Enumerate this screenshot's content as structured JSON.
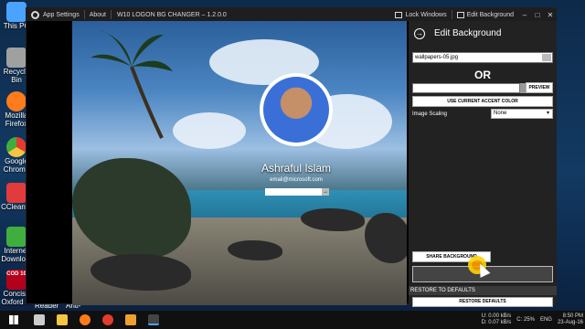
{
  "desktop": {
    "icons": [
      {
        "label": "This PC",
        "color": "#4aa3ff"
      },
      {
        "label": "Recycle Bin",
        "color": "#a0a0a0"
      },
      {
        "label": "Mozilla Firefox",
        "color": "#ff7b1b"
      },
      {
        "label": "Google Chrome",
        "color": "#e33b2e"
      },
      {
        "label": "CCleaner",
        "color": "#e23b3b"
      },
      {
        "label": "Internet Downlo...",
        "color": "#3fae3f"
      },
      {
        "label": "Concise Oxford ...",
        "color": "#b3001b",
        "badge": "COD 10"
      }
    ],
    "bottom_labels": [
      "Reader 9",
      "Anti-Mal..."
    ]
  },
  "app": {
    "title_settings": "App Settings",
    "title_about": "About",
    "window_title": "W10 LOGON BG CHANGER – 1.2.0.0",
    "lock_windows": "Lock Windows",
    "edit_background_tab": "Edit Background",
    "win_controls": {
      "minimize": "–",
      "maximize": "□",
      "close": "✕"
    }
  },
  "preview": {
    "user_name": "Ashraful Islam",
    "user_email": "email@microsoft.com",
    "go_arrow": "→"
  },
  "panel": {
    "title": "Edit Background",
    "file_name": "wallpapers-05.jpg",
    "or_label": "OR",
    "preview_button": "PREVIEW",
    "accent_button": "USE CURRENT ACCENT COLOR",
    "scaling_label": "Image Scaling",
    "scaling_value": "None",
    "share_button": "SHARE BACKGROUND",
    "restore_heading": "RESTORE TO DEFAULTS",
    "restore_button": "RESTORE DEFAULTS"
  },
  "taskbar": {
    "apps": [
      {
        "name": "search-icon",
        "color": "#cccccc"
      },
      {
        "name": "file-explorer-icon",
        "color": "#f4c542"
      },
      {
        "name": "firefox-icon",
        "color": "#ff7b1b"
      },
      {
        "name": "chrome-icon",
        "color": "#e33b2e"
      },
      {
        "name": "store-icon",
        "color": "#f0a030"
      },
      {
        "name": "w10-logon-app-icon",
        "color": "#444444"
      }
    ],
    "net_up": "U: 0.00 kB/s",
    "net_down": "D: 0.07 kB/s",
    "drive": "C: 25%",
    "lang": "ENG",
    "time": "8:50 PM",
    "date": "23-Aug-16"
  }
}
